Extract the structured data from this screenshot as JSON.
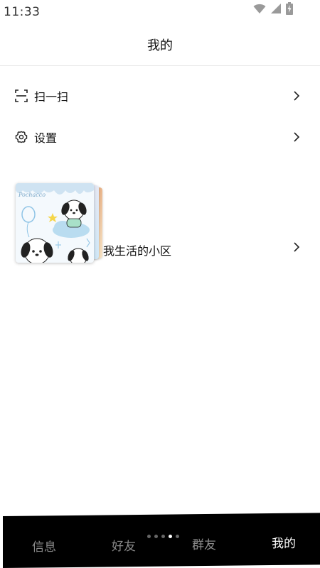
{
  "status_bar": {
    "time": "11:33",
    "icons": [
      "wifi-icon",
      "signal-icon",
      "battery-charging-icon"
    ]
  },
  "header": {
    "title": "我的"
  },
  "menu": {
    "items": [
      {
        "label": "扫一扫",
        "icon": "scan-icon"
      },
      {
        "label": "设置",
        "icon": "gear-icon"
      }
    ]
  },
  "community": {
    "label": "我生活的小区",
    "thumbnail_text": "Pochacco"
  },
  "bottom_nav": {
    "tabs": [
      {
        "label": "信息",
        "active": false
      },
      {
        "label": "好友",
        "active": false
      },
      {
        "label": "群友",
        "active": false
      },
      {
        "label": "我的",
        "active": true
      }
    ],
    "page_dots": 4,
    "active_dot": 3
  },
  "colors": {
    "nav_background": "#000000",
    "nav_active": "#ffffff",
    "nav_inactive": "#8a8a8a",
    "divider": "#e8e8e8"
  }
}
